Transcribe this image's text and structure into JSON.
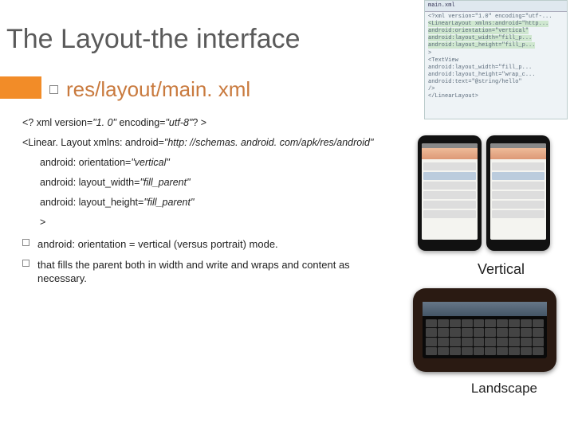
{
  "title": "The Layout-the interface",
  "subheader": "res/layout/main. xml",
  "code": {
    "l1a": "<? xml version=",
    "l1b": "\"1. 0\"",
    "l1c": " encoding=",
    "l1d": "\"utf-8\"",
    "l1e": "? >",
    "l2a": "<Linear. Layout xmlns: android=",
    "l2b": "\"http: //schemas. android. com/apk/res/android\"",
    "l3a": "android: orientation=",
    "l3b": "\"vertical\"",
    "l4a": "android: layout_width=",
    "l4b": "\"fill_parent\"",
    "l5a": "android: layout_height=",
    "l5b": "\"fill_parent\"",
    "l6": ">"
  },
  "annot": {
    "a1": "android: orientation  = vertical (versus portrait) mode.",
    "a2": "that fills the parent both in width and write and wraps and content as necessary."
  },
  "labels": {
    "vertical": "Vertical",
    "landscape": "Landscape"
  },
  "thumb": {
    "tab": "main.xml",
    "t1": "<?xml version=\"1.0\" encoding=\"utf-...",
    "t2": "<LinearLayout xmlns:android=\"http...",
    "t3": "    android:orientation=\"vertical\"",
    "t4": "    android:layout_width=\"fill_p...",
    "t5": "    android:layout_height=\"fill_p...",
    "t6": " >",
    "t7": "<TextView",
    "t8": "    android:layout_width=\"fill_p...",
    "t9": "    android:layout_height=\"wrap_c...",
    "t10": "    android:text=\"@string/hello\"",
    "t11": " />",
    "t12": "</LinearLayout>"
  }
}
